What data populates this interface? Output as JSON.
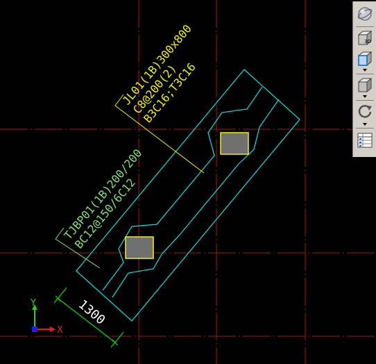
{
  "drawing": {
    "beam_label": {
      "line1": "JL01(1B)300x800",
      "line2": "C8@200(2)",
      "line3": "B3C16;T3C16"
    },
    "footing_label": {
      "line1": "TJBP01(1B)200/200",
      "line2": "BC12@150/6C12"
    },
    "dimension_text": "1300",
    "axis": {
      "x_label": "X",
      "y_label": "Y"
    },
    "colors": {
      "background": "#000000",
      "grid_lines": "#a01818",
      "outline": "#00e5e5",
      "beam_label": "#f2f200",
      "footing_label": "#80e080",
      "dimension": "#00e000",
      "column_fill": "#707070",
      "column_border": "#f2f200"
    }
  },
  "toolbar": {
    "items": [
      {
        "icon": "orbit-sphere-icon"
      },
      {
        "icon": "3d-view-icon",
        "text": "3D"
      },
      {
        "icon": "view-cube-front-icon"
      },
      {
        "icon": "view-cube-icon"
      },
      {
        "icon": "rotate-icon"
      },
      {
        "icon": "layer-properties-icon"
      }
    ]
  }
}
